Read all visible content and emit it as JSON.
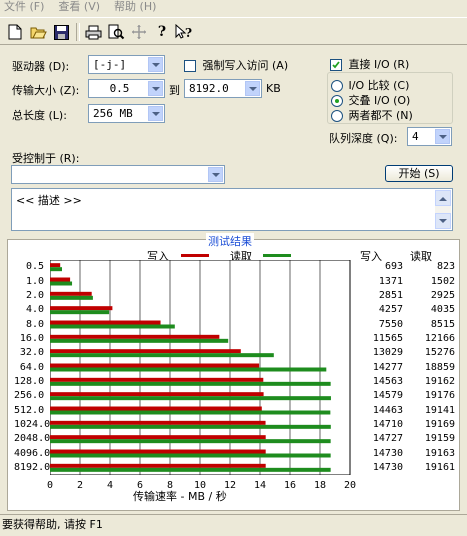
{
  "menu": {
    "items": [
      "文件 (F)",
      "查看 (V)",
      "帮助 (H)"
    ]
  },
  "toolbar": {
    "icons": [
      "new-icon",
      "open-icon",
      "save-icon",
      "print-icon",
      "print-preview-icon",
      "move-icon",
      "help-icon",
      "context-help-icon"
    ]
  },
  "form": {
    "drive_label": "驱动器 (D):",
    "drive_value": "[-j-]",
    "force_write_label": "强制写入访问 (A)",
    "transfer_size_label": "传输大小 (Z):",
    "transfer_from": "0.5",
    "to_label": "到",
    "transfer_to": "8192.0",
    "kb_label": "KB",
    "total_length_label": "总长度 (L):",
    "total_length_value": "256 MB",
    "controlled_by_label": "受控制于 (R):",
    "controlled_by_value": "",
    "description": "<< 描述 >>"
  },
  "io": {
    "direct_io_label": "直接 I/O (R)",
    "direct_io_checked": true,
    "options": [
      {
        "label": "I/O 比较 (C)",
        "selected": false
      },
      {
        "label": "交叠 I/O (O)",
        "selected": true
      },
      {
        "label": "两者都不 (N)",
        "selected": false
      }
    ],
    "queue_depth_label": "队列深度 (Q):",
    "queue_depth_value": "4"
  },
  "start_button": "开始 (S)",
  "results": {
    "title": "测试结果",
    "legend_write": "写入",
    "legend_read": "读取",
    "col_write": "写入",
    "col_read": "读取",
    "write_color": "#C00000",
    "read_color": "#1E8C1E",
    "rows": [
      {
        "size": "0.5",
        "write": "693",
        "read": "823"
      },
      {
        "size": "1.0",
        "write": "1371",
        "read": "1502"
      },
      {
        "size": "2.0",
        "write": "2851",
        "read": "2925"
      },
      {
        "size": "4.0",
        "write": "4257",
        "read": "4035"
      },
      {
        "size": "8.0",
        "write": "7550",
        "read": "8515"
      },
      {
        "size": "16.0",
        "write": "11565",
        "read": "12166"
      },
      {
        "size": "32.0",
        "write": "13029",
        "read": "15276"
      },
      {
        "size": "64.0",
        "write": "14277",
        "read": "18859"
      },
      {
        "size": "128.0",
        "write": "14563",
        "read": "19162"
      },
      {
        "size": "256.0",
        "write": "14579",
        "read": "19176"
      },
      {
        "size": "512.0",
        "write": "14463",
        "read": "19141"
      },
      {
        "size": "1024.0",
        "write": "14710",
        "read": "19169"
      },
      {
        "size": "2048.0",
        "write": "14727",
        "read": "19159"
      },
      {
        "size": "4096.0",
        "write": "14730",
        "read": "19163"
      },
      {
        "size": "8192.0",
        "write": "14730",
        "read": "19161"
      }
    ],
    "x_ticks": [
      "0",
      "2",
      "4",
      "6",
      "8",
      "10",
      "12",
      "14",
      "16",
      "18",
      "20"
    ],
    "xlabel": "传输速率 - MB / 秒"
  },
  "chart_data": {
    "type": "bar",
    "orientation": "horizontal",
    "categories": [
      "0.5",
      "1.0",
      "2.0",
      "4.0",
      "8.0",
      "16.0",
      "32.0",
      "64.0",
      "128.0",
      "256.0",
      "512.0",
      "1024.0",
      "2048.0",
      "4096.0",
      "8192.0"
    ],
    "series": [
      {
        "name": "写入",
        "values": [
          0.68,
          1.34,
          2.78,
          4.16,
          7.37,
          11.29,
          12.72,
          13.94,
          14.22,
          14.24,
          14.12,
          14.37,
          14.38,
          14.38,
          14.38
        ]
      },
      {
        "name": "读取",
        "values": [
          0.8,
          1.47,
          2.86,
          3.94,
          8.32,
          11.88,
          14.92,
          18.42,
          18.71,
          18.73,
          18.69,
          18.72,
          18.71,
          18.71,
          18.71
        ]
      }
    ],
    "title": "测试结果",
    "xlabel": "传输速率 - MB / 秒",
    "xlim": [
      0,
      20
    ],
    "grid": true,
    "legend": "top"
  },
  "status": "要获得帮助, 请按 F1"
}
